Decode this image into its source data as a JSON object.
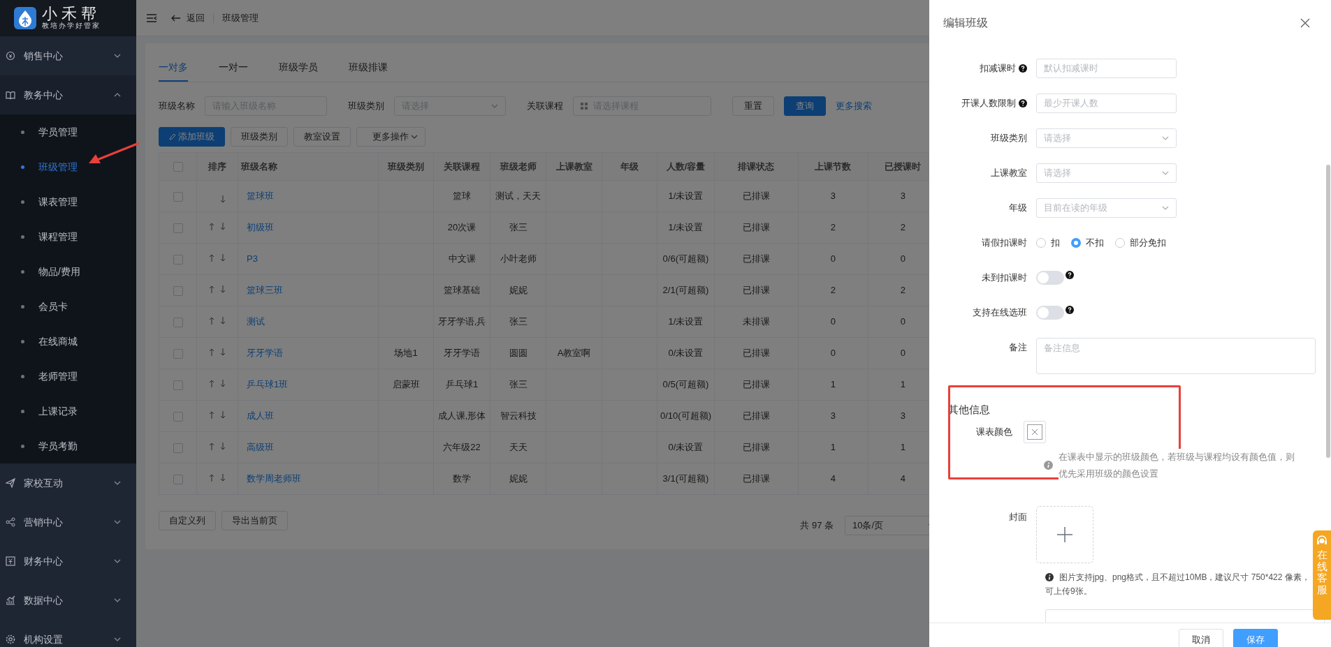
{
  "brand": {
    "name": "小禾帮",
    "tagline": "教培办学好管家"
  },
  "sidebar": {
    "pointer_arrow": true,
    "items": [
      {
        "label": "销售中心",
        "expanded": false
      },
      {
        "label": "教务中心",
        "expanded": true,
        "children": [
          {
            "label": "学员管理",
            "selected": false
          },
          {
            "label": "班级管理",
            "selected": true
          },
          {
            "label": "课表管理",
            "selected": false
          },
          {
            "label": "课程管理",
            "selected": false
          },
          {
            "label": "物品/费用",
            "selected": false
          },
          {
            "label": "会员卡",
            "selected": false
          },
          {
            "label": "在线商城",
            "selected": false
          },
          {
            "label": "老师管理",
            "selected": false
          },
          {
            "label": "上课记录",
            "selected": false
          },
          {
            "label": "学员考勤",
            "selected": false
          }
        ]
      },
      {
        "label": "家校互动",
        "expanded": false
      },
      {
        "label": "营销中心",
        "expanded": false
      },
      {
        "label": "财务中心",
        "expanded": false
      },
      {
        "label": "数据中心",
        "expanded": false
      },
      {
        "label": "机构设置",
        "expanded": false
      }
    ]
  },
  "topbar": {
    "back": "返回",
    "breadcrumb": "班级管理"
  },
  "tabs": [
    {
      "label": "一对多",
      "selected": true
    },
    {
      "label": "一对一",
      "selected": false
    },
    {
      "label": "班级学员",
      "selected": false
    },
    {
      "label": "班级排课",
      "selected": false
    }
  ],
  "filters": [
    {
      "kind": "text",
      "label": "班级名称",
      "placeholder": "请输入班级名称"
    },
    {
      "kind": "select",
      "label": "班级类别",
      "placeholder": "请选择"
    },
    {
      "kind": "course",
      "label": "关联课程",
      "placeholder": "请选择课程"
    }
  ],
  "filter_buttons": [
    {
      "kind": "default",
      "label": "重置"
    },
    {
      "kind": "primary",
      "label": "查询"
    },
    {
      "kind": "link",
      "label": "更多搜索"
    }
  ],
  "actions": [
    {
      "kind": "primary",
      "label": "添加班级"
    },
    {
      "kind": "default",
      "label": "班级类别"
    },
    {
      "kind": "default",
      "label": "教室设置"
    },
    {
      "kind": "dropdown",
      "label": "更多操作"
    }
  ],
  "table": {
    "all_checked": false,
    "columns": [
      "排序",
      "班级名称",
      "班级类别",
      "关联课程",
      "班级老师",
      "上课教室",
      "年级",
      "人数/容量",
      "排课状态",
      "上课节数",
      "已授课时"
    ],
    "rows": [
      {
        "checked": false,
        "can_move_up": false,
        "name": "篮球班",
        "course": "篮球",
        "teacher": "测试，天天",
        "count": "1/未设置",
        "status": "已排课",
        "lessons": "3",
        "taught": "3"
      },
      {
        "checked": false,
        "can_move_up": true,
        "name": "初级班",
        "course": "20次课",
        "teacher": "张三",
        "count": "1/未设置",
        "status": "已排课",
        "lessons": "2",
        "taught": "2"
      },
      {
        "checked": false,
        "can_move_up": true,
        "name": "P3",
        "course": "中文课",
        "teacher": "小叶老师",
        "count": "0/6(可超额)",
        "status": "已排课",
        "lessons": "0",
        "taught": "0"
      },
      {
        "checked": false,
        "can_move_up": true,
        "name": "篮球三班",
        "course": "篮球基础",
        "teacher": "妮妮",
        "count": "2/1(可超额)",
        "status": "已排课",
        "lessons": "2",
        "taught": "2"
      },
      {
        "checked": false,
        "can_move_up": true,
        "name": "测试",
        "course": "牙牙学语,兵",
        "teacher": "张三",
        "count": "1/未设置",
        "status": "未排课",
        "lessons": "0",
        "taught": "0"
      },
      {
        "checked": false,
        "can_move_up": true,
        "name": "牙牙学语",
        "type": "场地1",
        "course": "牙牙学语",
        "teacher": "圆圆",
        "room": "A教室啊",
        "count": "0/未设置",
        "status": "已排课",
        "lessons": "0",
        "taught": "0"
      },
      {
        "checked": false,
        "can_move_up": true,
        "name": "乒乓球1班",
        "type": "启蒙班",
        "course": "乒乓球1",
        "teacher": "张三",
        "count": "0/5(可超额)",
        "status": "已排课",
        "lessons": "1",
        "taught": "1"
      },
      {
        "checked": false,
        "can_move_up": true,
        "name": "成人班",
        "course": "成人课,形体",
        "teacher": "智云科技",
        "count": "0/10(可超额)",
        "status": "已排课",
        "lessons": "3",
        "taught": "3"
      },
      {
        "checked": false,
        "can_move_up": true,
        "name": "高级班",
        "course": "六年级22",
        "teacher": "天天",
        "count": "0/未设置",
        "status": "已排课",
        "lessons": "1",
        "taught": "1"
      },
      {
        "checked": false,
        "can_move_up": true,
        "name": "数学周老师班",
        "course": "数学",
        "teacher": "妮妮",
        "count": "3/1(可超额)",
        "status": "已排课",
        "lessons": "4",
        "taught": "4"
      }
    ]
  },
  "table_footer": {
    "buttons": [
      "自定义列",
      "导出当前页"
    ],
    "total": "共 97 条",
    "page_size": "10条/页"
  },
  "drawer": {
    "title": "编辑班级",
    "fields": [
      {
        "kind": "input",
        "label": "扣减课时",
        "help": true,
        "placeholder": "默认扣减课时"
      },
      {
        "kind": "input",
        "label": "开课人数限制",
        "help": true,
        "placeholder": "最少开课人数"
      },
      {
        "kind": "select",
        "label": "班级类别",
        "help": false,
        "placeholder": "请选择"
      },
      {
        "kind": "select",
        "label": "上课教室",
        "help": false,
        "placeholder": "请选择"
      },
      {
        "kind": "select",
        "label": "年级",
        "help": false,
        "placeholder": "目前在读的年级"
      },
      {
        "kind": "radio",
        "label": "请假扣课时",
        "help": false,
        "options": [
          {
            "label": "扣",
            "selected": false
          },
          {
            "label": "不扣",
            "selected": true
          },
          {
            "label": "部分免扣",
            "selected": false
          }
        ]
      },
      {
        "kind": "switch",
        "label": "未到扣课时",
        "help": true,
        "on": false
      },
      {
        "kind": "switch",
        "label": "支持在线选班",
        "help": true,
        "on": false
      },
      {
        "kind": "textarea",
        "label": "备注",
        "help": false,
        "placeholder": "备注信息"
      }
    ],
    "other_info": {
      "title": "其他信息",
      "highlighted": true,
      "color_label": "课表颜色",
      "hint": "在课表中显示的班级颜色，若班级与课程均设有颜色值，则优先采用班级的颜色设置"
    },
    "cover": {
      "label": "封面",
      "note_lines": [
        "图片支持jpg、png格式，且不超过10MB，建议尺寸 750*422 像素，",
        "可上传9张。"
      ]
    },
    "trailing_input": true,
    "buttons": [
      {
        "kind": "default",
        "label": "取消"
      },
      {
        "kind": "primary",
        "label": "保存"
      }
    ]
  },
  "online_service": {
    "label": "在线客服"
  }
}
